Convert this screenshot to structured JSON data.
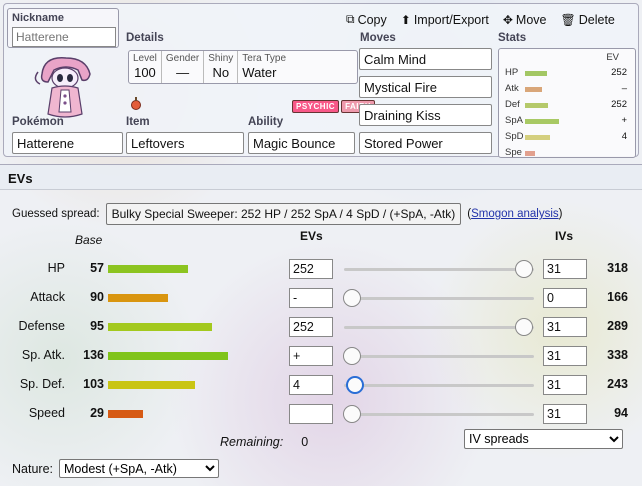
{
  "set": {
    "nickname_label": "Nickname",
    "nickname_placeholder": "Hatterene",
    "toolbar": {
      "copy": "Copy",
      "import_export": "Import/Export",
      "move": "Move",
      "delete": "Delete"
    },
    "details_label": "Details",
    "details": {
      "level_h": "Level",
      "level": "100",
      "gender_h": "Gender",
      "gender": "—",
      "shiny_h": "Shiny",
      "shiny": "No",
      "tera_h": "Tera Type",
      "tera": "Water"
    },
    "types": [
      {
        "name": "PSYCHIC",
        "color": "#f85888"
      },
      {
        "name": "FAIRY",
        "color": "#ee99ac"
      }
    ],
    "pokemon_label": "Pokémon",
    "pokemon": "Hatterene",
    "item_label": "Item",
    "item": "Leftovers",
    "ability_label": "Ability",
    "ability": "Magic Bounce",
    "moves_label": "Moves",
    "moves": [
      "Calm Mind",
      "Mystical Fire",
      "Draining Kiss",
      "Stored Power"
    ],
    "stats_label": "Stats",
    "stats_ev_head": "EV",
    "stats": [
      {
        "name": "HP",
        "ev": "252",
        "color": "#a3c764",
        "fill": 0.55
      },
      {
        "name": "Atk",
        "ev": "–",
        "color": "#d9a679",
        "fill": 0.42
      },
      {
        "name": "Def",
        "ev": "252",
        "color": "#b5c96a",
        "fill": 0.57
      },
      {
        "name": "SpA",
        "ev": "+",
        "color": "#a8c964",
        "fill": 0.85
      },
      {
        "name": "SpD",
        "ev": "4",
        "color": "#d4cf7f",
        "fill": 0.62
      },
      {
        "name": "Spe",
        "ev": "",
        "color": "#e2a08e",
        "fill": 0.26
      }
    ]
  },
  "evs": {
    "header": "EVs",
    "guessed_label": "Guessed spread:",
    "guessed_value": "Bulky Special Sweeper: 252 HP / 252 SpA / 4 SpD / (+SpA, -Atk)",
    "smogon_open": "(",
    "smogon_link": "Smogon analysis",
    "smogon_close": ")",
    "base_head": "Base",
    "evs_head": "EVs",
    "ivs_head": "IVs",
    "rows": [
      {
        "label": "HP",
        "base": "57",
        "bar_color": "#8cc420",
        "bar_fill": 0.57,
        "ev": "252",
        "slider": 1.0,
        "iv": "31",
        "total": "318"
      },
      {
        "label": "Attack",
        "base": "90",
        "bar_color": "#d9950f",
        "bar_fill": 0.43,
        "ev": "-",
        "slider": 0.0,
        "iv": "0",
        "total": "166"
      },
      {
        "label": "Defense",
        "base": "95",
        "bar_color": "#a3c91e",
        "bar_fill": 0.74,
        "ev": "252",
        "slider": 1.0,
        "iv": "31",
        "total": "289"
      },
      {
        "label": "Sp. Atk.",
        "base": "136",
        "bar_color": "#80c41a",
        "bar_fill": 0.86,
        "ev": "+",
        "slider": 0.0,
        "iv": "31",
        "total": "338"
      },
      {
        "label": "Sp. Def.",
        "base": "103",
        "bar_color": "#c9c514",
        "bar_fill": 0.62,
        "ev": "4",
        "slider": 0.016,
        "iv": "31",
        "total": "243"
      },
      {
        "label": "Speed",
        "base": "29",
        "bar_color": "#d65a14",
        "bar_fill": 0.25,
        "ev": "",
        "slider": 0.0,
        "iv": "31",
        "total": "94"
      }
    ],
    "remaining_label": "Remaining:",
    "remaining_value": "0",
    "iv_spreads": "IV spreads",
    "nature_label": "Nature:",
    "nature_value": "Modest (+SpA, -Atk)"
  }
}
